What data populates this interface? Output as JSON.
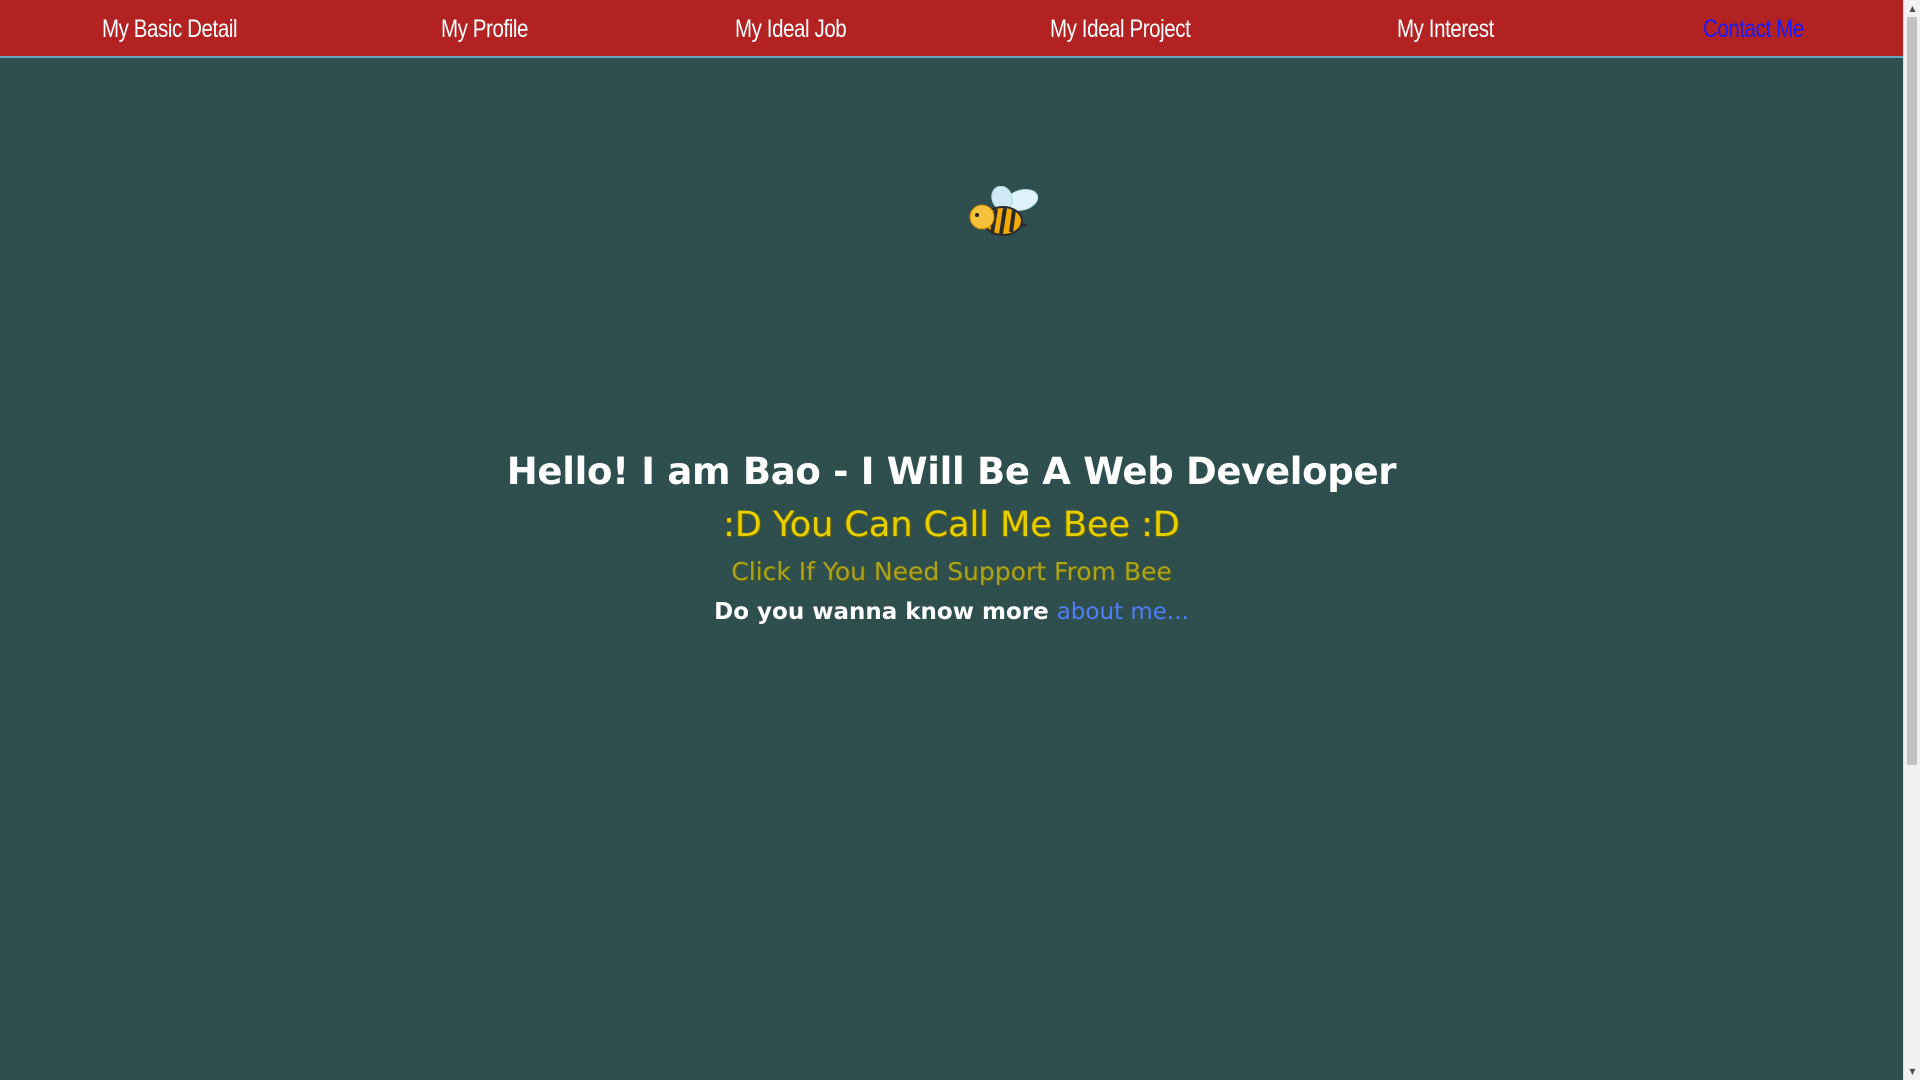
{
  "nav": {
    "items": [
      {
        "label": "My Basic Detail"
      },
      {
        "label": "My Profile"
      },
      {
        "label": "My Ideal Job"
      },
      {
        "label": "My Ideal Project"
      },
      {
        "label": "My Interest"
      },
      {
        "label": "Contact Me"
      }
    ],
    "active_index": 5
  },
  "hero": {
    "title": "Hello! I am Bao - I Will Be A Web Developer",
    "nickname": ":D You Can Call Me Bee :D",
    "support": "Click If You Need Support From Bee",
    "more_prefix": "Do you wanna know more ",
    "more_link": "about me..."
  },
  "icons": {
    "bee": "bee-icon"
  },
  "colors": {
    "nav_bg": "#b22222",
    "page_bg": "#2f4f4f",
    "active_link": "#1a1aff",
    "nickname": "#e6cf00",
    "support": "#a9a41c",
    "link": "#4f7df7"
  }
}
